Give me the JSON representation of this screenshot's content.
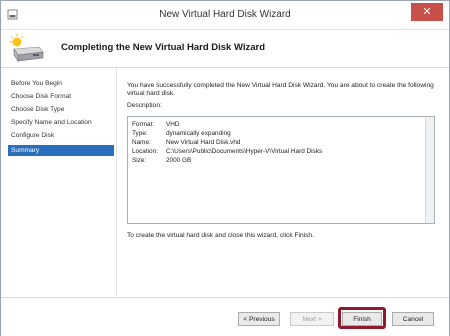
{
  "window": {
    "title": "New Virtual Hard Disk Wizard",
    "close_glyph": "✕"
  },
  "header": {
    "title": "Completing the New Virtual Hard Disk Wizard"
  },
  "sidebar": {
    "items": [
      {
        "label": "Before You Begin"
      },
      {
        "label": "Choose Disk Format"
      },
      {
        "label": "Choose Disk Type"
      },
      {
        "label": "Specify Name and Location"
      },
      {
        "label": "Configure Disk"
      },
      {
        "label": "Summary"
      }
    ],
    "selected_index": 5
  },
  "main": {
    "intro": "You have successfully completed the New Virtual Hard Disk Wizard. You are about to create the following virtual hard disk.",
    "description_label": "Description:",
    "details": [
      {
        "key": "Format:",
        "value": "VHD"
      },
      {
        "key": "Type:",
        "value": "dynamically expanding"
      },
      {
        "key": "Name:",
        "value": "New Virtual Hard Disk.vhd"
      },
      {
        "key": "Location:",
        "value": "C:\\Users\\Public\\Documents\\Hyper-V\\Virtual Hard Disks"
      },
      {
        "key": "Size:",
        "value": "2000 GB"
      }
    ],
    "outro": "To create the virtual hard disk and close this wizard, click Finish."
  },
  "footer": {
    "previous": "< Previous",
    "next": "Next >",
    "finish": "Finish",
    "cancel": "Cancel"
  },
  "colors": {
    "selection": "#2a6fbb",
    "highlight": "#8e1a2c",
    "close": "#c7504b"
  }
}
